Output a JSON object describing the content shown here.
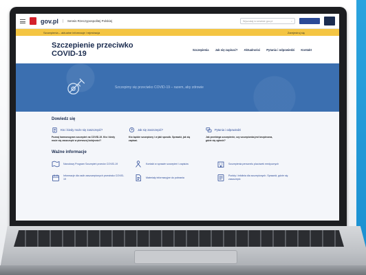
{
  "site": {
    "logo_text": "gov.pl",
    "site_name": "Serwis Rzeczypospolitej Polskiej",
    "search_placeholder": "Wyszukaj w serwisie gov.pl",
    "search_button": "Szukaj",
    "accessibility_label": "Dostępność"
  },
  "banner": {
    "text": "Szczepienia – aktualne informacje i rejestracja",
    "link": "Zarejestruj się"
  },
  "header": {
    "title_line1": "Szczepienie przeciwko",
    "title_line2": "COVID-19",
    "nav": [
      "Szczepienia",
      "Jak się zapisać?",
      "Aktualności",
      "Pytania i odpowiedzi",
      "Kontakt"
    ]
  },
  "hero": {
    "text": "Szczepimy się przeciwko COVID-19 – razem, aby zdrowie"
  },
  "learn": {
    "title": "Dowiedz się",
    "cards": [
      {
        "icon": "clipboard-icon",
        "title": "Kto i kiedy może się zaszczepić?",
        "desc": "Poznaj harmonogram szczepień na COVID-19. Kto i kiedy może się zaszczepić w pierwszej kolejności?"
      },
      {
        "icon": "question-bubble-icon",
        "title": "Jak się zaszczepić?",
        "desc": "Kto będzie szczepiony i w jaki sposób. Sprawdź, jak się zapisać."
      },
      {
        "icon": "chat-bubbles-icon",
        "title": "Pytania i odpowiedzi",
        "desc": "Jak przebiega szczepienie, czy szczepionka jest bezpieczna, gdzie się zgłosić?"
      }
    ]
  },
  "important": {
    "title": "Ważne informacje",
    "items": [
      {
        "icon": "map-icon",
        "label": "Narodowy Program Szczepień przeciw COVID-19"
      },
      {
        "icon": "person-icon",
        "label": "Kontakt w sprawie szczepień i zapisów"
      },
      {
        "icon": "building-icon",
        "label": "Szczepienia personelu placówek medycznych"
      },
      {
        "icon": "calendar-icon",
        "label": "Informacje dla osób zaszczepionych przeciwko COVID-19"
      },
      {
        "icon": "document-icon",
        "label": "Materiały informacyjne do pobrania"
      },
      {
        "icon": "list-icon",
        "label": "Punkty i infolinia dla szczepionych. Sprawdź, gdzie się zaszczepić"
      }
    ]
  },
  "colors": {
    "brand_navy": "#1b2c4f",
    "brand_blue": "#2b4a97",
    "banner_yellow": "#f4c543",
    "hero_blue": "#3b6fb0",
    "logo_red": "#d4212b",
    "side_stripe": "#1b8fd0"
  }
}
